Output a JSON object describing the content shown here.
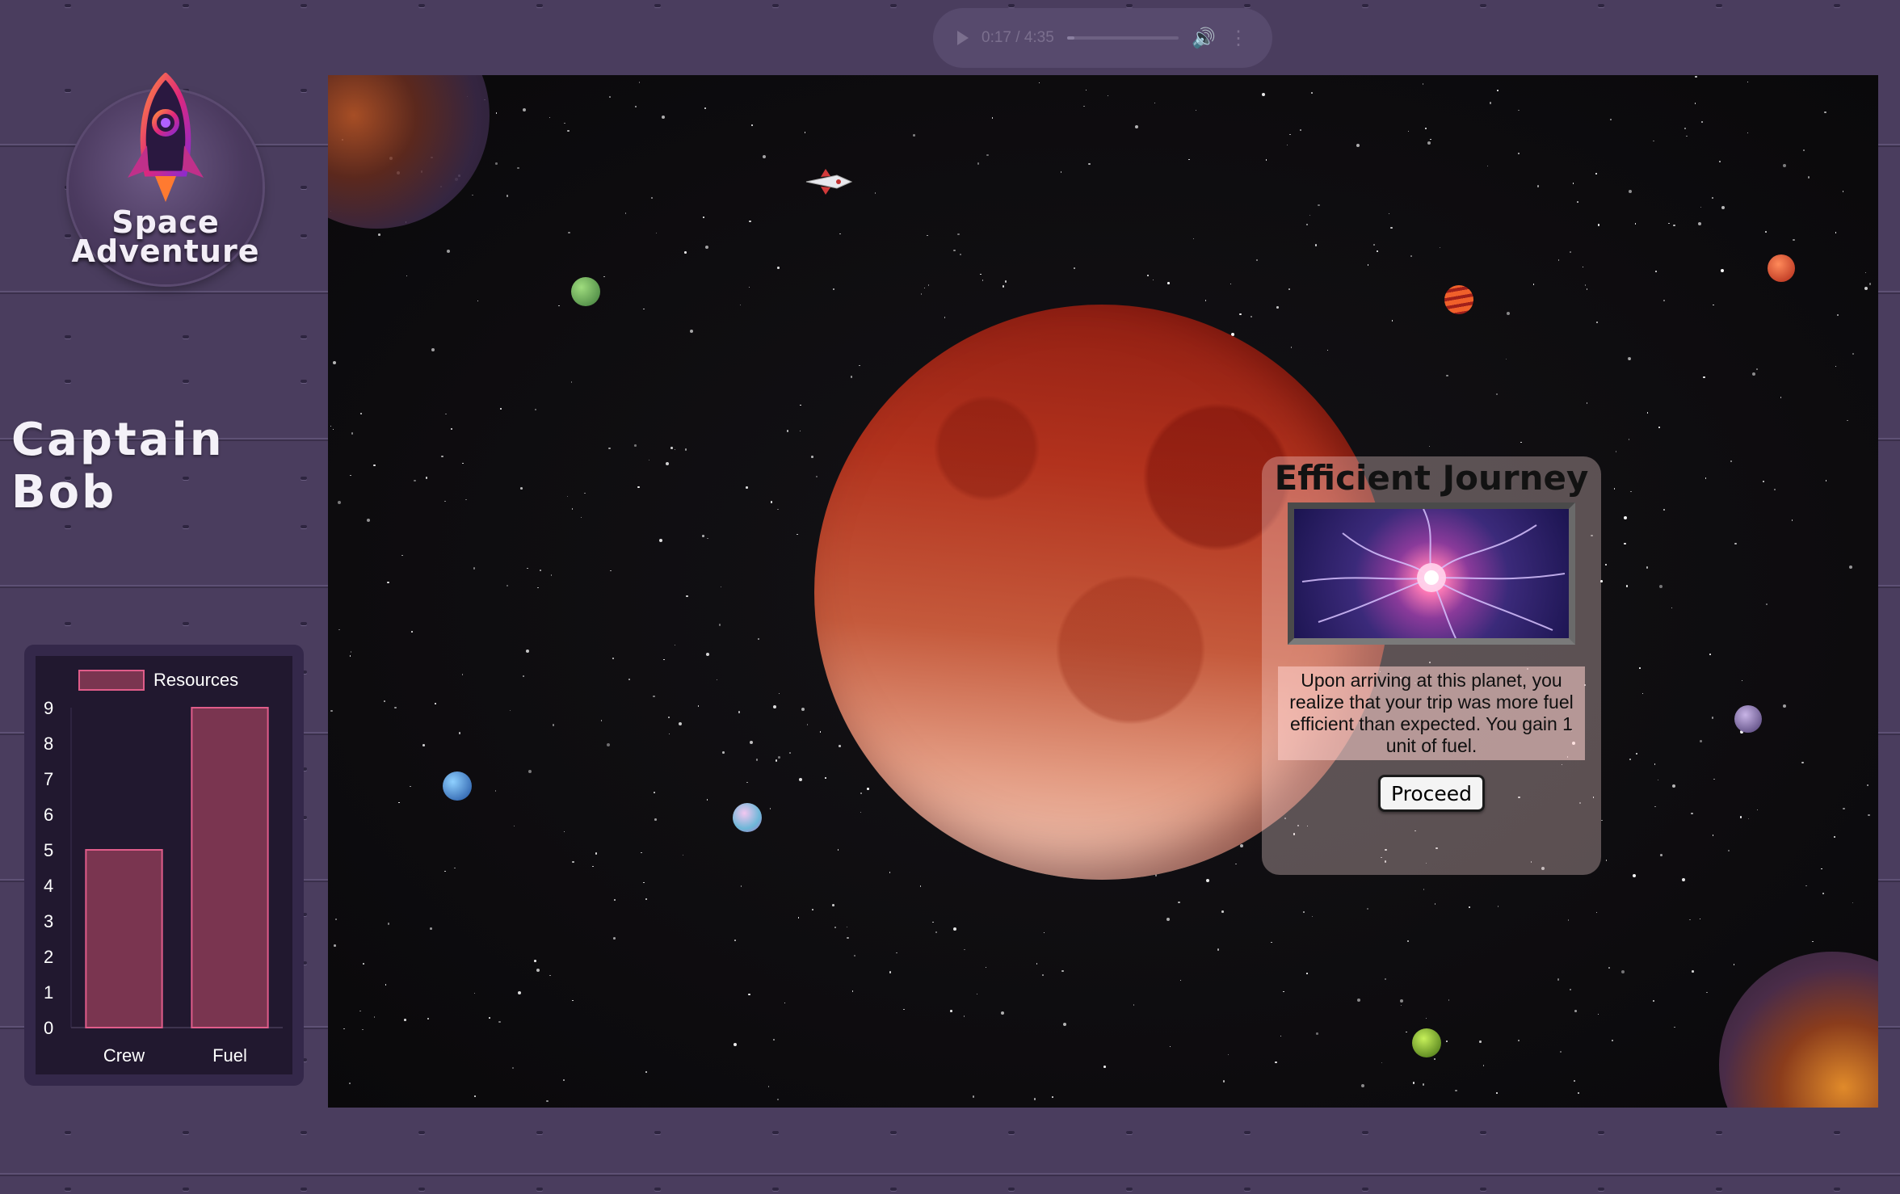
{
  "audio": {
    "time": "0:17 / 4:35",
    "progress": 0.065
  },
  "logo": {
    "line1": "Space",
    "line2": "Adventure"
  },
  "player": {
    "name": "Captain Bob"
  },
  "chart_data": {
    "type": "bar",
    "legend": [
      "Resources"
    ],
    "categories": [
      "Crew",
      "Fuel"
    ],
    "series": [
      {
        "name": "Resources",
        "values": [
          5,
          9
        ]
      }
    ],
    "yticks": [
      "0",
      "1",
      "2",
      "3",
      "4",
      "5",
      "6",
      "7",
      "8",
      "9"
    ],
    "ylim": [
      0,
      9
    ],
    "colors": {
      "fill": "#7a3550",
      "stroke": "#e05c8a"
    }
  },
  "event": {
    "title": "Efficient Journey",
    "description": "Upon arriving at this planet, you realize that your trip was more fuel efficient than expected. You gain 1 unit of fuel.",
    "button": "Proceed"
  }
}
